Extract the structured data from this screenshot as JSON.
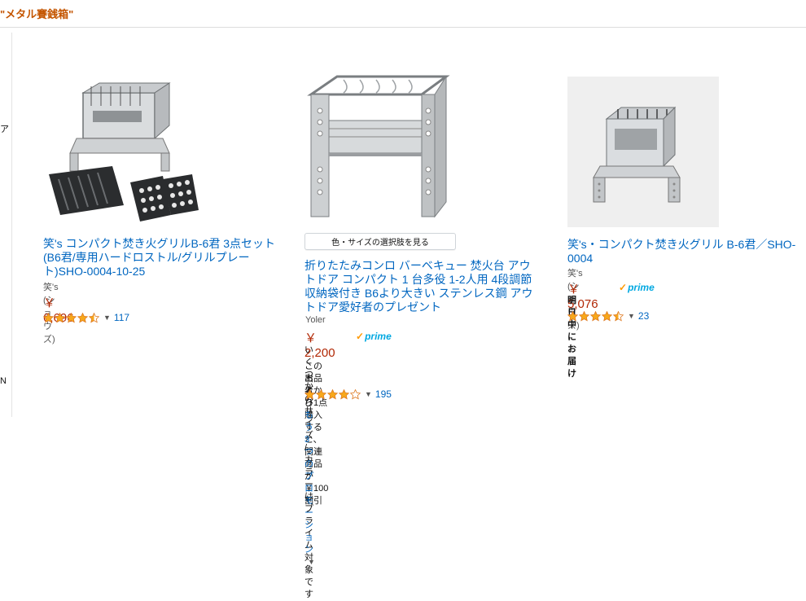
{
  "search": {
    "query_label": "\"メタル賽銭箱\""
  },
  "leftrail": {
    "chars": [
      "ア",
      "N"
    ]
  },
  "colors": {
    "link": "#0066c0",
    "price": "#b12704",
    "prime": "#00a8e1"
  },
  "products": [
    {
      "title": "笑's コンパクト焚き火グリルB-6君 3点セット(B6君/専用ハードロストル/グリルプレート)SHO-0004-10-25",
      "brand": "笑's (ショウズ)",
      "price": "￥ 6,696",
      "rating_value": 4.5,
      "rating_count": "117"
    },
    {
      "variant_button": "色・サイズの選択肢を見る",
      "title": "折りたたみコンロ バーベキュー 焚火台 アウトドア コンパクト 1 台多役 1-2人用 4段調節 収納袋付き B6より大きい ステンレス鋼 アウトドア愛好者のプレゼント",
      "brand": "Yoler",
      "price": "￥ 2,200",
      "prime": "prime",
      "note": "いくつかのサイズ / カラーはプライム対象です",
      "promo_line1": "この出品者から1点購入すると、関連商品が￥100割引",
      "promo_prefix": "および",
      "promo_link": "もう3つのプロモーション",
      "rating_value": 4.0,
      "rating_count": "195"
    },
    {
      "title": "笑's・コンパクト焚き火グリル B-6君／SHO-0004",
      "brand": "笑's (ショウズ)",
      "price": "￥ 5,076",
      "prime": "prime",
      "delivery": "明日中にお届け",
      "rating_value": 4.5,
      "rating_count": "23"
    }
  ]
}
